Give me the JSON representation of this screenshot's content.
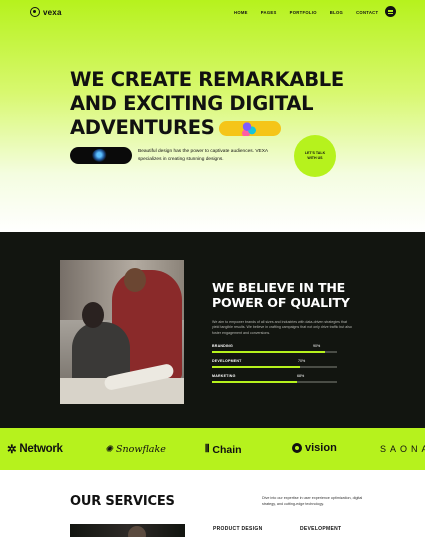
{
  "brand": {
    "name": "vexa"
  },
  "nav": {
    "items": [
      "HOME",
      "PAGES",
      "PORTFOLIO",
      "BLOG",
      "CONTACT"
    ]
  },
  "hero": {
    "headline_lines": [
      "WE CREATE REMARKABLE",
      "AND EXCITING DIGITAL",
      "ADVENTURES"
    ],
    "description": "Beautiful design has the power to captivate audiences. VEXA specializes in creating stunning designs.",
    "cta": "LET'S TALK WITH US"
  },
  "believe": {
    "title_lines": [
      "WE BELIEVE IN THE",
      "POWER OF QUALITY"
    ],
    "text": "We aim to empower brands of all sizes and industries with data-driven strategies that yield tangible results. We believe in crafting campaigns that not only drive traffic but also foster engagement and conversions.",
    "skills": [
      {
        "label": "BRANDING",
        "percent_label": "90%",
        "value": 0.9
      },
      {
        "label": "DEVELOPMENT",
        "percent_label": "70%",
        "value": 0.7
      },
      {
        "label": "MARKETING",
        "percent_label": "68%",
        "value": 0.68
      }
    ]
  },
  "logos": [
    "Network",
    "Snowflake",
    "Chain",
    "vision",
    "SAONA"
  ],
  "services": {
    "title": "OUR SERVICES",
    "text": "Dive into our expertise in user experience optimization, digital strategy, and cutting-edge technology.",
    "categories": [
      "PRODUCT DESIGN",
      "DEVELOPMENT"
    ]
  },
  "colors": {
    "accent": "#b6f21d",
    "dark": "#121510",
    "pill": "#f5c518"
  }
}
